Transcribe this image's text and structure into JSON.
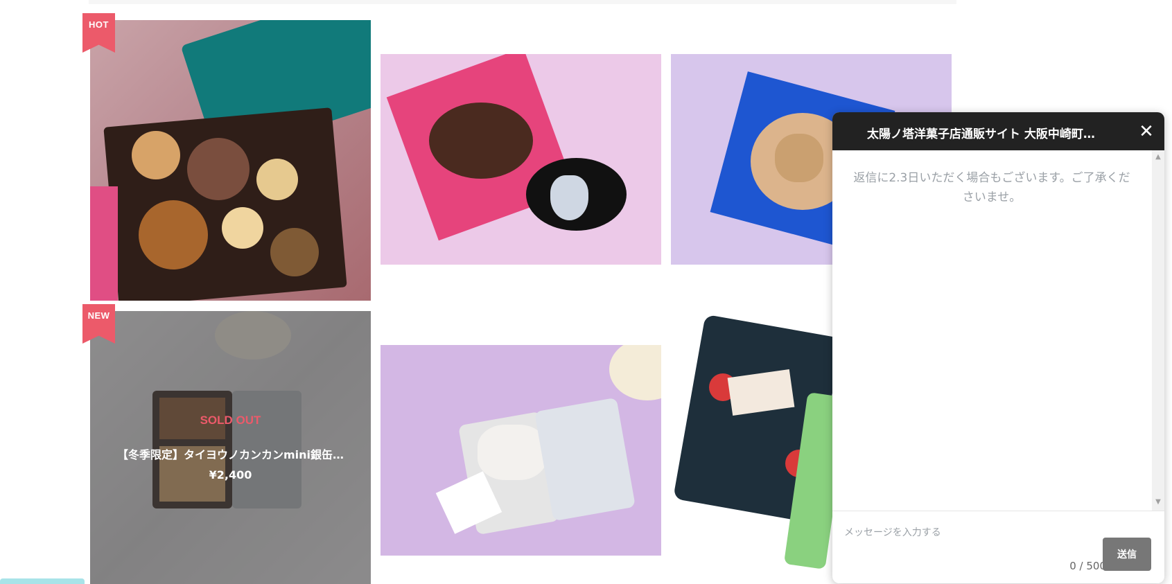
{
  "products": [
    {
      "badge": "HOT",
      "colors": {
        "bg": "#c9a3a8"
      }
    },
    {
      "badge": "",
      "colors": {
        "bg": "#ecc9e8"
      }
    },
    {
      "badge": "",
      "colors": {
        "bg": "#d7c6ec"
      }
    },
    {
      "badge": "NEW",
      "sold_out_label": "SOLD OUT",
      "name": "【冬季限定】タイヨウノカンカンmini銀缶…",
      "price": "¥2,400"
    },
    {
      "badge": ""
    },
    {
      "badge": ""
    }
  ],
  "chat": {
    "title": "太陽ノ塔洋菓子店通販サイト 大阪中崎町…",
    "close_icon": "close-icon",
    "notice": "返信に2.3日いただく場合もございます。ご了承くださいませ。",
    "input_placeholder": "メッセージを入力する",
    "counter": "0 / 500",
    "send_label": "送信"
  },
  "colors": {
    "ribbon": "#ec5a6a",
    "chat_header": "#222222",
    "send_button": "#777777",
    "sold_out": "#ec5a6a"
  }
}
